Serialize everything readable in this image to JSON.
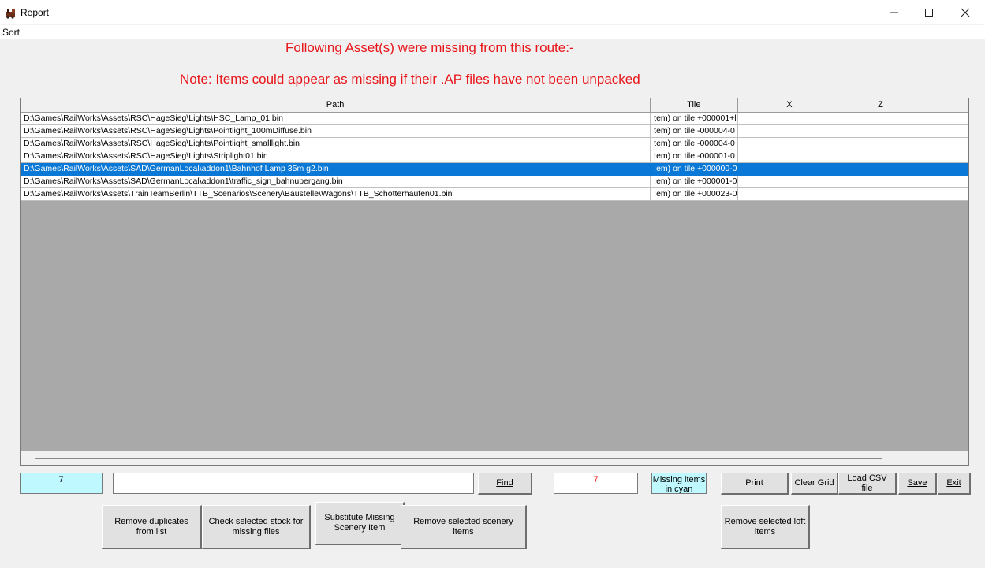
{
  "window": {
    "title": "Report",
    "minimize": "—",
    "maximize": "☐",
    "close": "✕"
  },
  "menu": {
    "sort": "Sort"
  },
  "headings": {
    "line1": "Following Asset(s) were missing from this route:-",
    "line2": "Note: Items could appear as missing if their .AP files have not been unpacked"
  },
  "grid": {
    "columns": [
      "Path",
      "Tile",
      "X",
      "Z",
      ""
    ],
    "rows": [
      {
        "path": "D:\\Games\\RailWorks\\Assets\\RSC\\HageSieg\\Lights\\HSC_Lamp_01.bin",
        "tile": "tem) on tile +000001+l",
        "selected": false
      },
      {
        "path": "D:\\Games\\RailWorks\\Assets\\RSC\\HageSieg\\Lights\\Pointlight_100mDiffuse.bin",
        "tile": "tem) on tile -000004-0",
        "selected": false
      },
      {
        "path": "D:\\Games\\RailWorks\\Assets\\RSC\\HageSieg\\Lights\\Pointlight_smalllight.bin",
        "tile": "tem) on tile -000004-0",
        "selected": false
      },
      {
        "path": "D:\\Games\\RailWorks\\Assets\\RSC\\HageSieg\\Lights\\Striplight01.bin",
        "tile": "tem) on tile -000001-0",
        "selected": false
      },
      {
        "path": "D:\\Games\\RailWorks\\Assets\\SAD\\GermanLocal\\addon1\\Bahnhof Lamp 35m g2.bin",
        "tile": ":em) on tile +000000-0",
        "selected": true
      },
      {
        "path": "D:\\Games\\RailWorks\\Assets\\SAD\\GermanLocal\\addon1\\traffic_sign_bahnubergang.bin",
        "tile": ":em) on tile +000001-0",
        "selected": false
      },
      {
        "path": "D:\\Games\\RailWorks\\Assets\\TrainTeamBerlin\\TTB_Scenarios\\Scenery\\Baustelle\\Wagons\\TTB_Schotterhaufen01.bin",
        "tile": ":em) on tile +000023-0",
        "selected": false
      }
    ]
  },
  "controls": {
    "count_left": "7",
    "find_value": "",
    "find_label": "Find",
    "count_right": "7",
    "legend_cyan": "Missing items in cyan",
    "print": "Print",
    "clear_grid": "Clear Grid",
    "load_csv": "Load CSV file",
    "save": "Save",
    "exit": "Exit",
    "remove_duplicates": "Remove duplicates from list",
    "check_stock": "Check selected stock for missing files",
    "substitute": "Substitute Missing Scenery Item",
    "remove_scenery": "Remove selected scenery items",
    "remove_loft": "Remove selected loft items"
  },
  "colors": {
    "heading": "#e8161a",
    "selection": "#0a78d7",
    "cyan": "#bff9ff",
    "grid_empty": "#a9a9a9"
  }
}
